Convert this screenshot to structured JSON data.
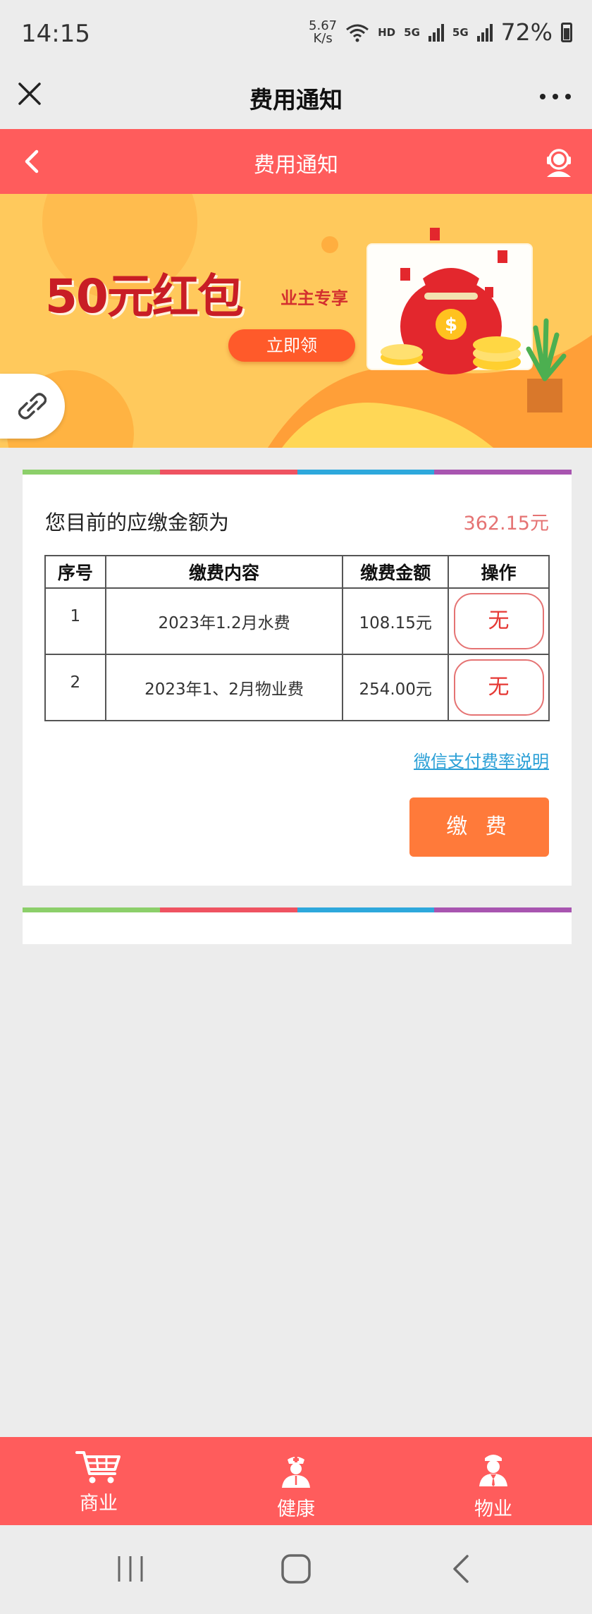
{
  "status_bar": {
    "time": "14:15",
    "speed_value": "5.67",
    "speed_unit": "K/s",
    "hd": "HD",
    "net1": "5G",
    "net2": "5G",
    "battery": "72%"
  },
  "wechat_bar": {
    "title": "费用通知"
  },
  "header": {
    "title": "费用通知"
  },
  "banner": {
    "title": "50元红包",
    "subtitle": "业主专享",
    "button": "立即领"
  },
  "colors": {
    "primary_red": "#ff5c5c",
    "banner_yellow": "#ffc95c",
    "pay_orange": "#ff7a3a",
    "link_blue": "#2a9fd6",
    "stripe": [
      "#8ccf6a",
      "#ef5361",
      "#2ea8dc",
      "#a855b0"
    ]
  },
  "fee": {
    "amount_label": "您目前的应缴金额为",
    "amount_value": "362.15元",
    "columns": [
      "序号",
      "缴费内容",
      "缴费金额",
      "操作"
    ],
    "rows": [
      {
        "index": "1",
        "content": "2023年1.2月水费",
        "amount": "108.15元",
        "action": "无"
      },
      {
        "index": "2",
        "content": "2023年1、2月物业费",
        "amount": "254.00元",
        "action": "无"
      }
    ],
    "rate_link": "微信支付费率说明",
    "pay_button": "缴 费"
  },
  "tabs": [
    {
      "label": "商业",
      "icon": "cart-icon"
    },
    {
      "label": "健康",
      "icon": "doctor-icon"
    },
    {
      "label": "物业",
      "icon": "staff-icon"
    }
  ]
}
